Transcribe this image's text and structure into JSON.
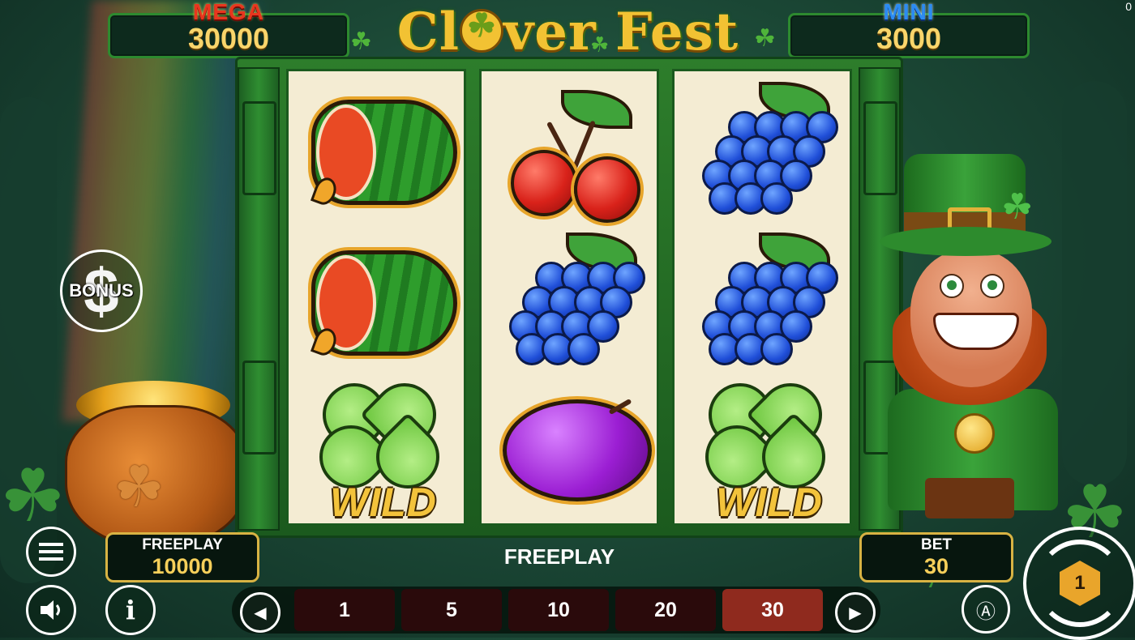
{
  "jackpots": {
    "mega": {
      "title": "MEGA",
      "value": "30000"
    },
    "mini": {
      "title": "MINI",
      "value": "3000"
    }
  },
  "logo": {
    "text_left": "Cl",
    "text_right": "ver Fest"
  },
  "reels": [
    [
      "watermelon",
      "watermelon",
      "clover-wild"
    ],
    [
      "cherries",
      "grapes",
      "plum"
    ],
    [
      "grapes",
      "grapes",
      "clover-wild"
    ]
  ],
  "wild_label": "WILD",
  "bonus": {
    "label": "BONUS"
  },
  "freeplay_panel": {
    "label": "FREEPLAY",
    "value": "10000"
  },
  "status_text": "FREEPLAY",
  "bet_panel": {
    "label": "BET",
    "value": "30"
  },
  "bet_options": [
    "1",
    "5",
    "10",
    "20",
    "30"
  ],
  "selected_bet": "30",
  "corner_counter": "0",
  "colors": {
    "accent_gold": "#f6cf5a",
    "selected_bet": "#8f2a1e",
    "panel_border": "#d8b343"
  }
}
